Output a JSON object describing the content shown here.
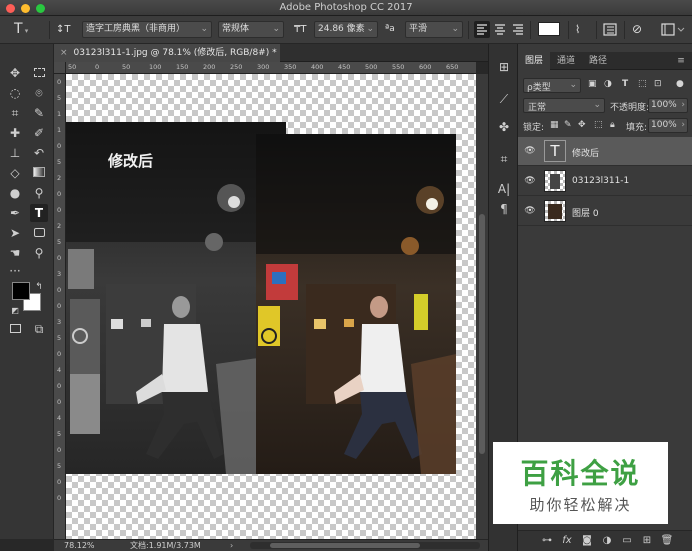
{
  "window": {
    "title": "Adobe Photoshop CC 2017"
  },
  "options": {
    "font_family": "造字工房典黑（非商用）",
    "font_style": "常规体",
    "font_size": "24.86 像素",
    "aa_label": "ªa",
    "antialias": "平滑",
    "type_tool_glyph": "T",
    "orient_glyph": "↕T"
  },
  "document": {
    "tab_title": "03123l311-1.jpg @ 78.1% (修改后, RGB/8#) *",
    "canvas_label": "修改后",
    "zoom": "78.12%",
    "doc_info": "文档:1.91M/3.73M",
    "ruler_top": [
      "50",
      "0",
      "50",
      "100",
      "150",
      "200",
      "250",
      "300",
      "350",
      "400",
      "450",
      "500",
      "550",
      "600",
      "650"
    ],
    "ruler_left": [
      "0",
      "5",
      "1",
      "1",
      "0",
      "5",
      "2",
      "0",
      "0",
      "2",
      "5",
      "0",
      "3",
      "0",
      "0",
      "3",
      "5",
      "0",
      "4",
      "0",
      "0",
      "4",
      "5",
      "0",
      "5",
      "0",
      "0"
    ]
  },
  "panels": {
    "tabs": [
      "图层",
      "通道",
      "路径"
    ],
    "filter_kind": "ρ类型",
    "blend_mode": "正常",
    "opacity_label": "不透明度:",
    "opacity": "100%",
    "lock_label": "锁定:",
    "fill_label": "填充:",
    "fill": "100%",
    "layers": [
      {
        "name": "修改后",
        "type": "text",
        "selected": true
      },
      {
        "name": "03123l311-1",
        "type": "image",
        "selected": false
      },
      {
        "name": "图层 0",
        "type": "image",
        "selected": false
      }
    ]
  },
  "watermark": {
    "title": "百科全说",
    "subtitle": "助你轻松解决"
  },
  "colors": {
    "accent": "#3ea043",
    "panel": "#3a3a3a",
    "toolbar": "#353535"
  }
}
